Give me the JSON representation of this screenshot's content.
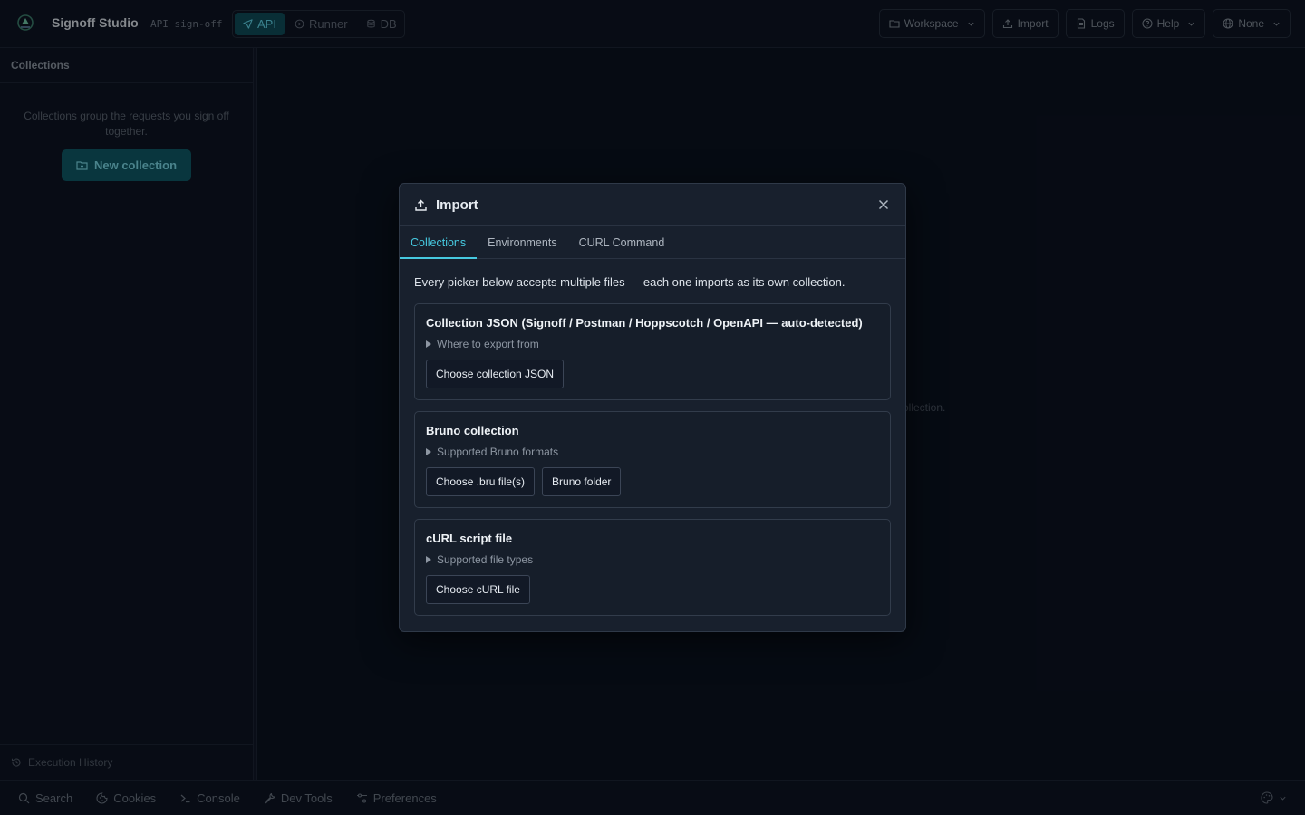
{
  "app": {
    "title": "Signoff Studio",
    "subtitle": "API sign-off",
    "modes": [
      {
        "label": "API",
        "active": true
      },
      {
        "label": "Runner",
        "active": false
      },
      {
        "label": "DB",
        "active": false
      }
    ]
  },
  "topbar": {
    "workspace_label": "Workspace",
    "import_label": "Import",
    "logs_label": "Logs",
    "help_label": "Help",
    "environment_label": "None"
  },
  "sidebar": {
    "title": "Collections",
    "empty_text": "Collections group the requests you sign off together.",
    "new_collection_label": "New collection",
    "execution_history_label": "Execution History"
  },
  "main": {
    "background_hint": "ollection."
  },
  "bottombar": {
    "items": [
      {
        "label": "Search",
        "icon": "search-icon"
      },
      {
        "label": "Cookies",
        "icon": "cookie-icon"
      },
      {
        "label": "Console",
        "icon": "terminal-icon"
      },
      {
        "label": "Dev Tools",
        "icon": "wrench-icon"
      },
      {
        "label": "Preferences",
        "icon": "sliders-icon"
      }
    ]
  },
  "modal": {
    "title": "Import",
    "tabs": [
      {
        "label": "Collections",
        "active": true
      },
      {
        "label": "Environments",
        "active": false
      },
      {
        "label": "CURL Command",
        "active": false
      }
    ],
    "intro": "Every picker below accepts multiple files — each one imports as its own collection.",
    "cards": [
      {
        "title": "Collection JSON (Signoff / Postman / Hoppscotch / OpenAPI — auto-detected)",
        "details": "Where to export from",
        "buttons": [
          "Choose collection JSON"
        ]
      },
      {
        "title": "Bruno collection",
        "details": "Supported Bruno formats",
        "buttons": [
          "Choose .bru file(s)",
          "Bruno folder"
        ]
      },
      {
        "title": "cURL script file",
        "details": "Supported file types",
        "buttons": [
          "Choose cURL file"
        ]
      }
    ]
  },
  "colors": {
    "accent": "#46c9e0",
    "primary_button": "#0f5864",
    "background": "#0b1220",
    "modal_bg": "#18202d"
  }
}
